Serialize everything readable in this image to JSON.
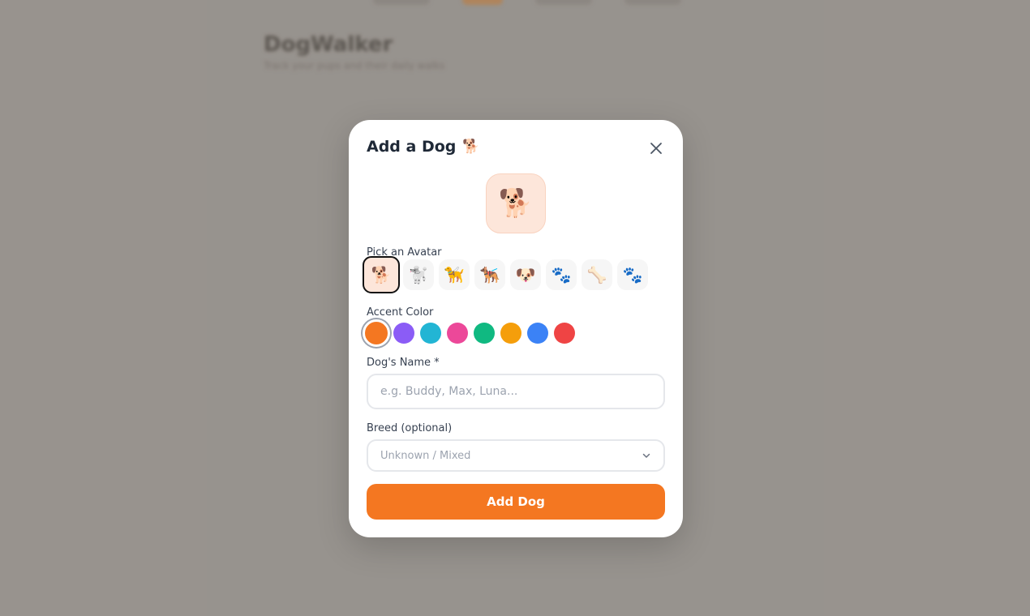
{
  "background": {
    "title": "DogWalker",
    "subtitle": "Track your pups and their daily walks"
  },
  "modal": {
    "title": "Add a Dog",
    "title_emoji": "🐕",
    "close_icon": "close-icon",
    "preview_emoji": "🐕",
    "avatar_label": "Pick an Avatar",
    "avatars": [
      "🐕",
      "🐩",
      "🦮",
      "🐕‍🦺",
      "🐶",
      "🐾",
      "🦴",
      "🐾"
    ],
    "selected_avatar": 0,
    "color_label": "Accent Color",
    "colors": [
      "#f47721",
      "#8b5cf6",
      "#22b5d4",
      "#ec4899",
      "#10b981",
      "#f59e0b",
      "#3b82f6",
      "#ef4444"
    ],
    "selected_color": 0,
    "name_label": "Dog's Name *",
    "name_placeholder": "e.g. Buddy, Max, Luna...",
    "name_value": "",
    "breed_label": "Breed (optional)",
    "breed_value": "Unknown / Mixed",
    "submit_label": "Add Dog"
  }
}
